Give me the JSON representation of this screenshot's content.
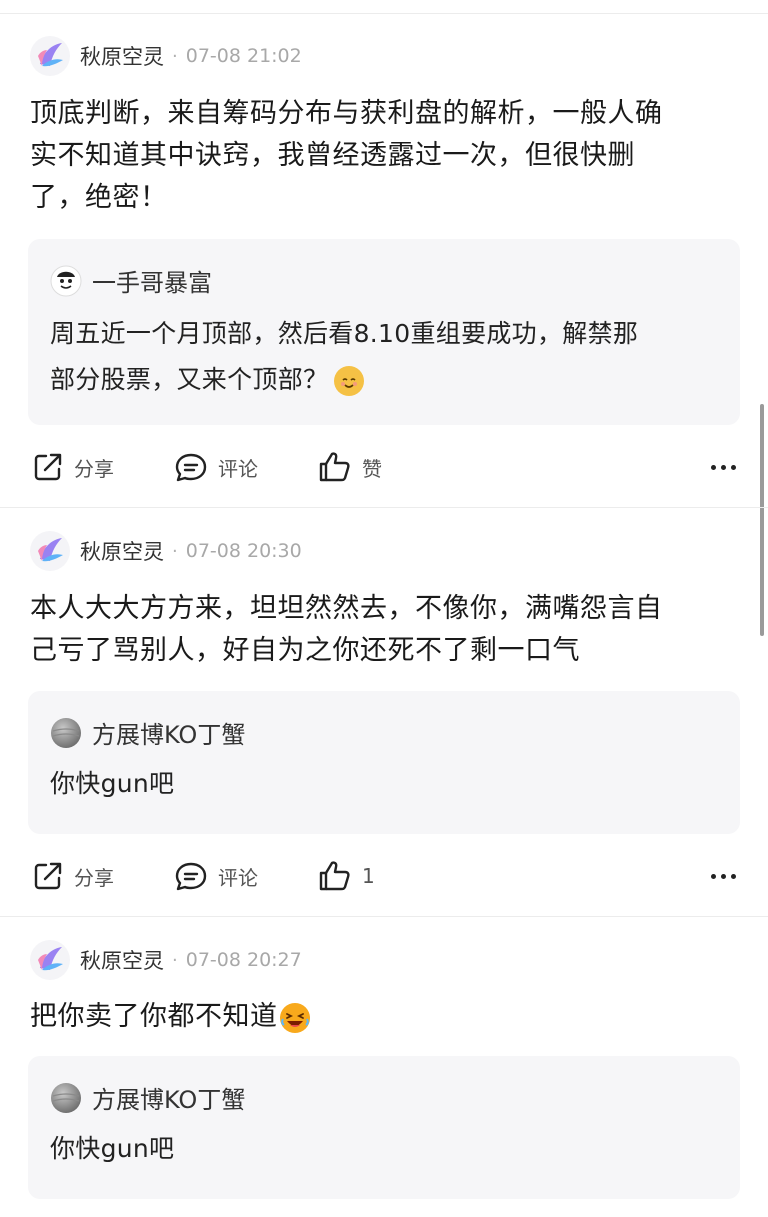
{
  "posts": [
    {
      "author": "秋原空灵",
      "time": "07-08 21:02",
      "content_lines": [
        "顶底判断，来自筹码分布与获利盘的解析，一般人确",
        "实不知道其中诀窍，我曾经透露过一次，但很快删",
        "了，绝密！"
      ],
      "quote": {
        "author": "一手哥暴富",
        "avatar_icon": "cartoon-face-icon",
        "text_lines": [
          "周五近一个月顶部，然后看8.10重组要成功，解禁那",
          "部分股票，又来个顶部？"
        ],
        "emoji": "cat-face-emoji"
      },
      "actions": {
        "share": "分享",
        "comment": "评论",
        "like": "赞"
      }
    },
    {
      "author": "秋原空灵",
      "time": "07-08 20:30",
      "content_lines": [
        "本人大大方方来，坦坦然然去，不像你，满嘴怨言自",
        "己亏了骂别人，好自为之你还死不了剩一口气"
      ],
      "quote": {
        "author": "方展博KO丁蟹",
        "avatar_icon": "gray-sphere-icon",
        "text_lines": [
          "你快gun吧"
        ]
      },
      "actions": {
        "share": "分享",
        "comment": "评论",
        "like": "1"
      }
    },
    {
      "author": "秋原空灵",
      "time": "07-08 20:27",
      "content_lines": [
        "把你卖了你都不知道"
      ],
      "content_emoji": "laughing-face-emoji",
      "quote": {
        "author": "方展博KO丁蟹",
        "avatar_icon": "gray-sphere-icon",
        "text_lines": [
          "你快gun吧"
        ]
      }
    }
  ],
  "separator_dot": "·",
  "colors": {
    "accent_purple": "#8a6cf0",
    "accent_blue": "#4aa3f5",
    "background": "#ffffff",
    "quote_bg": "#f6f6f8"
  }
}
